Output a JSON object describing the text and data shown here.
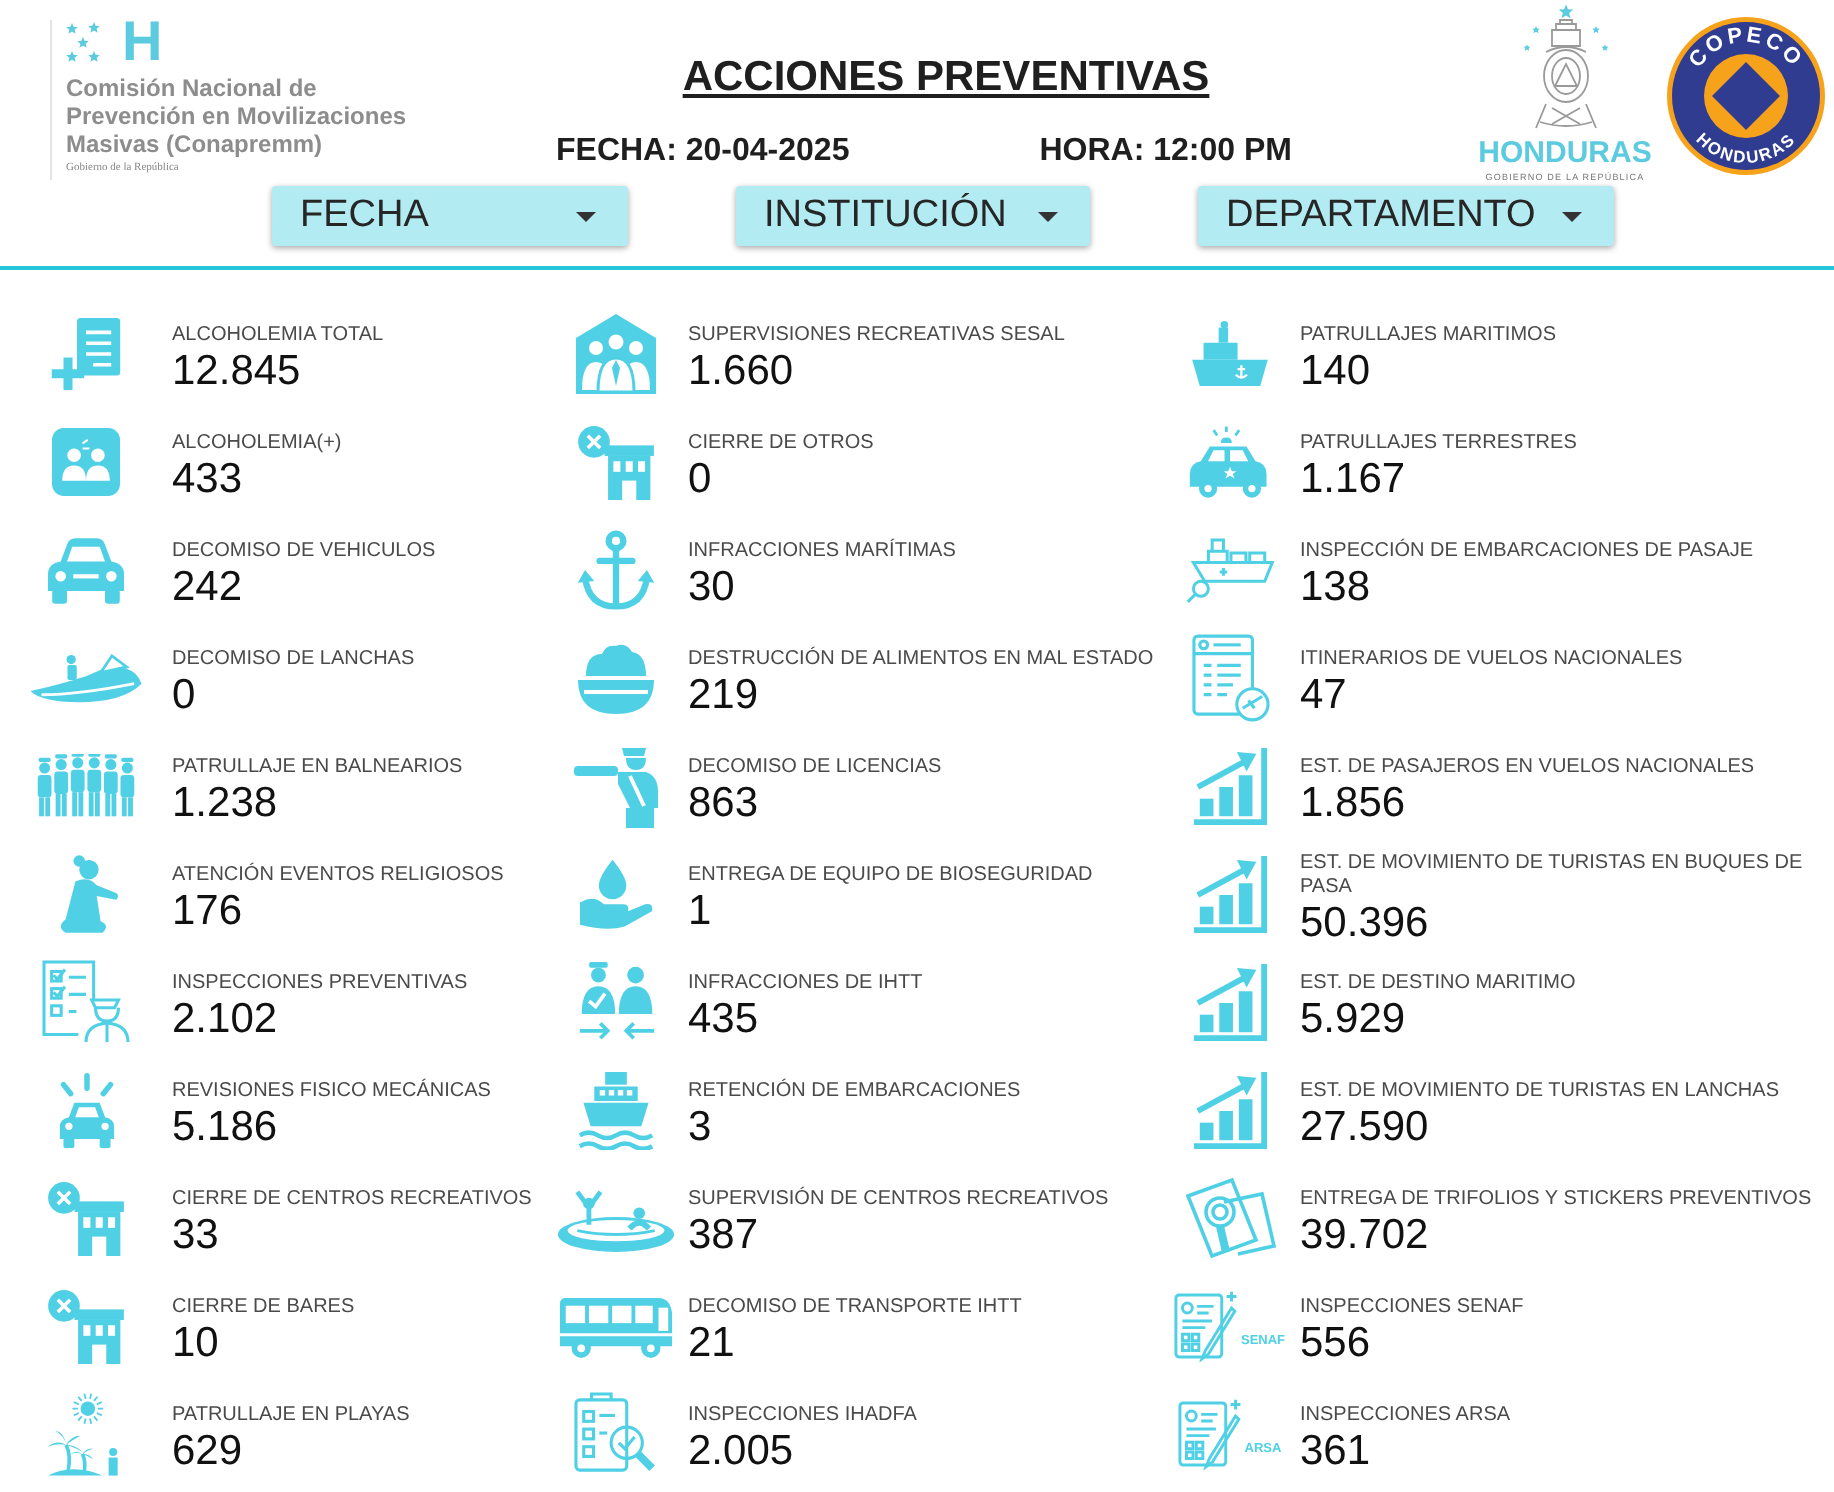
{
  "header": {
    "logo": {
      "mark": "H",
      "name_lines": [
        "Comisión Nacional de",
        "Prevención en Movilizaciones",
        "Masivas (Conapremm)"
      ],
      "tagline": "Gobierno de la República"
    },
    "title": "ACCIONES PREVENTIVAS",
    "date": "FECHA: 20-04-2025",
    "time": "HORA: 12:00 PM",
    "government_logo": {
      "name": "HONDURAS",
      "tagline": "GOBIERNO DE LA REPÚBLICA"
    },
    "seal": {
      "top_text": "COPECO",
      "bottom_text": "HONDURAS"
    }
  },
  "filters": [
    {
      "label": "FECHA"
    },
    {
      "label": "INSTITUCIÓN"
    },
    {
      "label": "DEPARTAMENTO"
    }
  ],
  "columns": [
    {
      "items": [
        {
          "label": "ALCOHOLEMIA TOTAL",
          "value": "12.845"
        },
        {
          "label": "ALCOHOLEMIA(+)",
          "value": "433"
        },
        {
          "label": "DECOMISO DE VEHICULOS",
          "value": "242"
        },
        {
          "label": "DECOMISO DE LANCHAS",
          "value": "0"
        },
        {
          "label": "PATRULLAJE EN BALNEARIOS",
          "value": "1.238"
        },
        {
          "label": "ATENCIÓN EVENTOS RELIGIOSOS",
          "value": "176"
        },
        {
          "label": "INSPECCIONES PREVENTIVAS",
          "value": "2.102"
        },
        {
          "label": "REVISIONES FISICO MECÁNICAS",
          "value": "5.186"
        },
        {
          "label": "CIERRE DE CENTROS RECREATIVOS",
          "value": "33"
        },
        {
          "label": "CIERRE DE BARES",
          "value": "10"
        },
        {
          "label": "PATRULLAJE EN PLAYAS",
          "value": "629"
        }
      ]
    },
    {
      "items": [
        {
          "label": "SUPERVISIONES RECREATIVAS SESAL",
          "value": "1.660"
        },
        {
          "label": "CIERRE DE OTROS",
          "value": "0"
        },
        {
          "label": "INFRACCIONES MARÍTIMAS",
          "value": "30"
        },
        {
          "label": "DESTRUCCIÓN DE ALIMENTOS EN MAL ESTADO",
          "value": "219"
        },
        {
          "label": "DECOMISO DE LICENCIAS",
          "value": "863"
        },
        {
          "label": "ENTREGA DE EQUIPO DE BIOSEGURIDAD",
          "value": "1"
        },
        {
          "label": "INFRACCIONES DE IHTT",
          "value": "435"
        },
        {
          "label": "RETENCIÓN DE EMBARCACIONES",
          "value": "3"
        },
        {
          "label": "SUPERVISIÓN DE CENTROS RECREATIVOS",
          "value": "387"
        },
        {
          "label": "DECOMISO DE TRANSPORTE IHTT",
          "value": "21"
        },
        {
          "label": "INSPECCIONES IHADFA",
          "value": "2.005"
        }
      ]
    },
    {
      "items": [
        {
          "label": "PATRULLAJES MARITIMOS",
          "value": "140"
        },
        {
          "label": "PATRULLAJES TERRESTRES",
          "value": "1.167"
        },
        {
          "label": "INSPECCIÓN DE EMBARCACIONES DE PASAJE",
          "value": "138"
        },
        {
          "label": "ITINERARIOS DE VUELOS NACIONALES",
          "value": "47"
        },
        {
          "label": "EST. DE PASAJEROS EN VUELOS NACIONALES",
          "value": "1.856"
        },
        {
          "label": "EST. DE MOVIMIENTO DE TURISTAS EN BUQUES DE PASA",
          "value": "50.396"
        },
        {
          "label": "EST. DE DESTINO MARITIMO",
          "value": "5.929"
        },
        {
          "label": "EST. DE MOVIMIENTO DE TURISTAS EN LANCHAS",
          "value": "27.590"
        },
        {
          "label": "ENTREGA DE TRIFOLIOS Y STICKERS PREVENTIVOS",
          "value": "39.702"
        },
        {
          "label": "INSPECCIONES SENAF",
          "value": "556",
          "icon_tag": "SENAF"
        },
        {
          "label": "INSPECCIONES ARSA",
          "value": "361",
          "icon_tag": "ARSA"
        }
      ]
    }
  ]
}
